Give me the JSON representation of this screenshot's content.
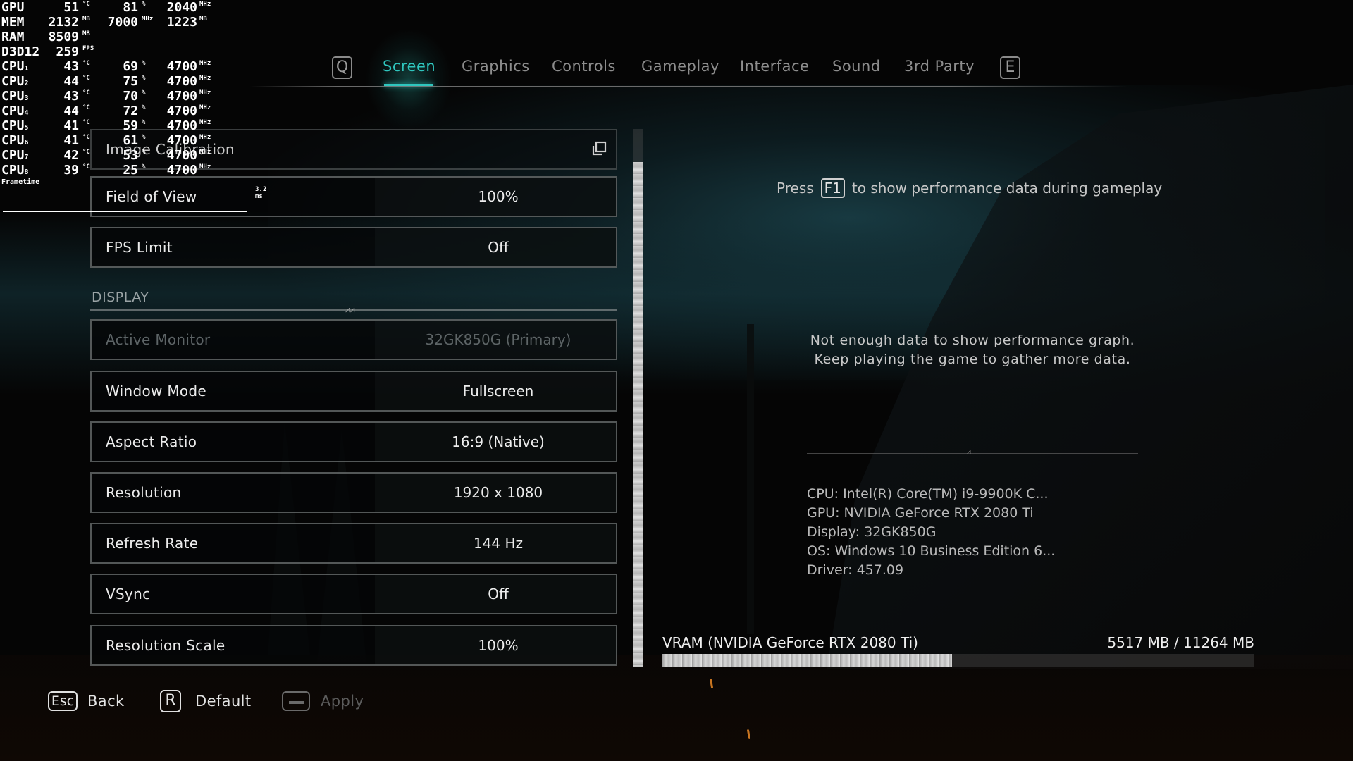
{
  "osd": {
    "rows": [
      {
        "label": "GPU",
        "sub": "",
        "v1": "51",
        "u1": "°C",
        "v2": "81",
        "u2": "%",
        "v3": "2040",
        "u3": "MHz"
      },
      {
        "label": "MEM",
        "sub": "",
        "v1": "2132",
        "u1": "MB",
        "v2": "7000",
        "u2": "MHz",
        "v3": "1223",
        "u3": "MB"
      },
      {
        "label": "RAM",
        "sub": "",
        "v1": "8509",
        "u1": "MB",
        "v2": "",
        "u2": "",
        "v3": "",
        "u3": ""
      },
      {
        "label": "D3D12",
        "sub": "",
        "v1": "259",
        "u1": "FPS",
        "v2": "",
        "u2": "",
        "v3": "",
        "u3": ""
      },
      {
        "label": "CPU",
        "sub": "1",
        "v1": "43",
        "u1": "°C",
        "v2": "69",
        "u2": "%",
        "v3": "4700",
        "u3": "MHz"
      },
      {
        "label": "CPU",
        "sub": "2",
        "v1": "44",
        "u1": "°C",
        "v2": "75",
        "u2": "%",
        "v3": "4700",
        "u3": "MHz"
      },
      {
        "label": "CPU",
        "sub": "3",
        "v1": "43",
        "u1": "°C",
        "v2": "70",
        "u2": "%",
        "v3": "4700",
        "u3": "MHz"
      },
      {
        "label": "CPU",
        "sub": "4",
        "v1": "44",
        "u1": "°C",
        "v2": "72",
        "u2": "%",
        "v3": "4700",
        "u3": "MHz"
      },
      {
        "label": "CPU",
        "sub": "5",
        "v1": "41",
        "u1": "°C",
        "v2": "59",
        "u2": "%",
        "v3": "4700",
        "u3": "MHz"
      },
      {
        "label": "CPU",
        "sub": "6",
        "v1": "41",
        "u1": "°C",
        "v2": "61",
        "u2": "%",
        "v3": "4700",
        "u3": "MHz"
      },
      {
        "label": "CPU",
        "sub": "7",
        "v1": "42",
        "u1": "°C",
        "v2": "53",
        "u2": "%",
        "v3": "4700",
        "u3": "MHz"
      },
      {
        "label": "CPU",
        "sub": "8",
        "v1": "39",
        "u1": "°C",
        "v2": "25",
        "u2": "%",
        "v3": "4700",
        "u3": "MHz"
      }
    ],
    "frametime_label": "Frametime",
    "frametime_value": "3.2 ms"
  },
  "tabs": {
    "prev_key": "Q",
    "next_key": "E",
    "items": [
      {
        "label": "Screen",
        "active": true
      },
      {
        "label": "Graphics",
        "active": false
      },
      {
        "label": "Controls",
        "active": false
      },
      {
        "label": "Gameplay",
        "active": false
      },
      {
        "label": "Interface",
        "active": false
      },
      {
        "label": "Sound",
        "active": false
      },
      {
        "label": "3rd Party",
        "active": false
      }
    ]
  },
  "settings": {
    "image_calibration": {
      "label": "Image Calibration",
      "icon": "external-window-icon"
    },
    "general": [
      {
        "label": "Field of View",
        "value": "100%"
      },
      {
        "label": "FPS Limit",
        "value": "Off"
      }
    ],
    "display_section_label": "DISPLAY",
    "display": [
      {
        "label": "Active Monitor",
        "value": "32GK850G (Primary)",
        "disabled": true
      },
      {
        "label": "Window Mode",
        "value": "Fullscreen",
        "disabled": false
      },
      {
        "label": "Aspect Ratio",
        "value": "16:9 (Native)",
        "disabled": false
      },
      {
        "label": "Resolution",
        "value": "1920 x 1080",
        "disabled": false
      },
      {
        "label": "Refresh Rate",
        "value": "144 Hz",
        "disabled": false
      },
      {
        "label": "VSync",
        "value": "Off",
        "disabled": false
      },
      {
        "label": "Resolution Scale",
        "value": "100%",
        "disabled": false
      }
    ]
  },
  "performance": {
    "press_prefix": "Press",
    "press_key": "F1",
    "press_suffix": "to show performance data during gameplay",
    "no_data_line1": "Not enough data to show performance graph.",
    "no_data_line2": "Keep playing the game to gather more data.",
    "sysinfo": [
      "CPU: Intel(R) Core(TM) i9-9900K C...",
      "GPU: NVIDIA GeForce RTX 2080 Ti",
      "Display: 32GK850G",
      "OS: Windows 10 Business Edition 6...",
      "Driver: 457.09"
    ],
    "vram_label": "VRAM (NVIDIA GeForce RTX 2080 Ti)",
    "vram_value": "5517 MB / 11264 MB",
    "vram_used_mb": 5517,
    "vram_total_mb": 11264
  },
  "footer": {
    "back_key": "Esc",
    "back_label": "Back",
    "default_key": "R",
    "default_label": "Default",
    "apply_key": "space",
    "apply_label": "Apply"
  },
  "colors": {
    "accent": "#2fc6be",
    "text": "#ececec",
    "disabled_text": "#5d6466"
  }
}
